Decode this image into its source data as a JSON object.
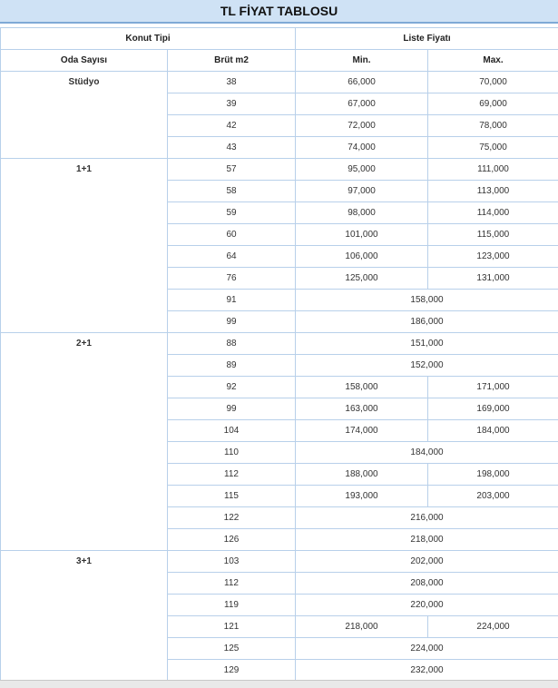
{
  "title": "TL FİYAT TABLOSU",
  "header": {
    "konut_tipi": "Konut Tipi",
    "liste_fiyati": "Liste Fiyatı",
    "oda_sayisi": "Oda Sayısı",
    "brut": "Brüt m2",
    "min": "Min.",
    "max": "Max."
  },
  "groups": [
    {
      "room": "Stüdyo",
      "rows": [
        {
          "area": "38",
          "min": "66,000",
          "max": "70,000"
        },
        {
          "area": "39",
          "min": "67,000",
          "max": "69,000"
        },
        {
          "area": "42",
          "min": "72,000",
          "max": "78,000"
        },
        {
          "area": "43",
          "min": "74,000",
          "max": "75,000"
        }
      ]
    },
    {
      "room": "1+1",
      "rows": [
        {
          "area": "57",
          "min": "95,000",
          "max": "111,000"
        },
        {
          "area": "58",
          "min": "97,000",
          "max": "113,000"
        },
        {
          "area": "59",
          "min": "98,000",
          "max": "114,000"
        },
        {
          "area": "60",
          "min": "101,000",
          "max": "115,000"
        },
        {
          "area": "64",
          "min": "106,000",
          "max": "123,000"
        },
        {
          "area": "76",
          "min": "125,000",
          "max": "131,000"
        },
        {
          "area": "91",
          "price": "158,000"
        },
        {
          "area": "99",
          "price": "186,000"
        }
      ]
    },
    {
      "room": "2+1",
      "rows": [
        {
          "area": "88",
          "price": "151,000"
        },
        {
          "area": "89",
          "price": "152,000"
        },
        {
          "area": "92",
          "min": "158,000",
          "max": "171,000"
        },
        {
          "area": "99",
          "min": "163,000",
          "max": "169,000"
        },
        {
          "area": "104",
          "min": "174,000",
          "max": "184,000"
        },
        {
          "area": "110",
          "price": "184,000"
        },
        {
          "area": "112",
          "min": "188,000",
          "max": "198,000"
        },
        {
          "area": "115",
          "min": "193,000",
          "max": "203,000"
        },
        {
          "area": "122",
          "price": "216,000"
        },
        {
          "area": "126",
          "price": "218,000"
        }
      ]
    },
    {
      "room": "3+1",
      "rows": [
        {
          "area": "103",
          "price": "202,000"
        },
        {
          "area": "112",
          "price": "208,000"
        },
        {
          "area": "119",
          "price": "220,000"
        },
        {
          "area": "121",
          "min": "218,000",
          "max": "224,000"
        },
        {
          "area": "125",
          "price": "224,000"
        },
        {
          "area": "129",
          "price": "232,000"
        }
      ]
    }
  ]
}
